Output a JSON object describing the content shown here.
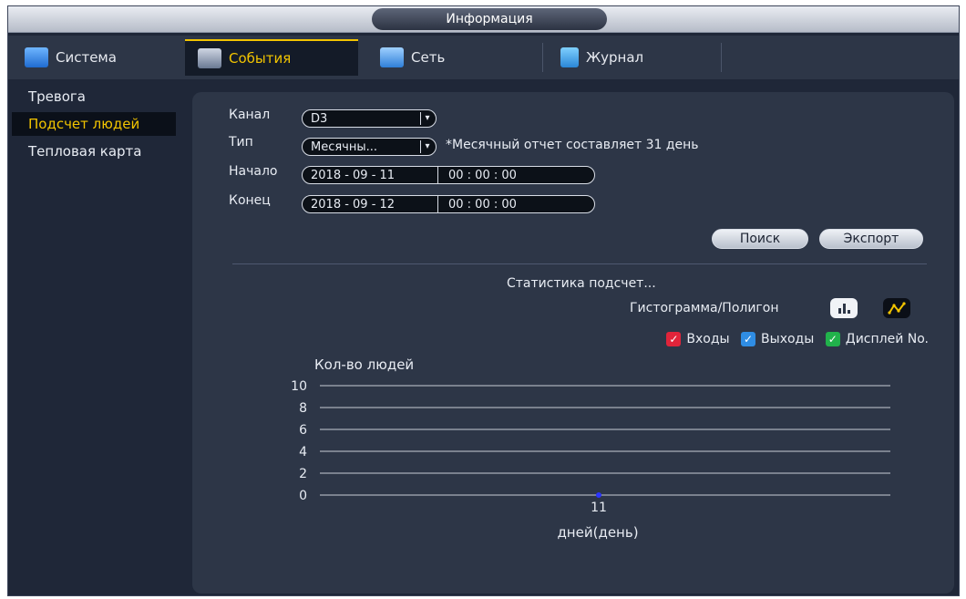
{
  "window": {
    "title": "Информация"
  },
  "tabs": [
    {
      "label": "Система",
      "icon": "monitor-icon"
    },
    {
      "label": "События",
      "icon": "events-icon"
    },
    {
      "label": "Сеть",
      "icon": "network-icon"
    },
    {
      "label": "Журнал",
      "icon": "journal-icon"
    }
  ],
  "sidebar": {
    "items": [
      {
        "label": "Тревога"
      },
      {
        "label": "Подсчет людей"
      },
      {
        "label": "Тепловая карта"
      }
    ]
  },
  "form": {
    "channel_label": "Канал",
    "channel_value": "D3",
    "type_label": "Тип",
    "type_value": "Месячны...",
    "type_note": "*Месячный отчет составляет 31 день",
    "start_label": "Начало",
    "start_date": "2018  - 09 - 11",
    "start_time": "00 : 00 : 00",
    "end_label": "Конец",
    "end_date": "2018  - 09 - 12",
    "end_time": "00 : 00 : 00",
    "search_button": "Поиск",
    "export_button": "Экспорт"
  },
  "stats": {
    "title": "Статистика подсчет...",
    "mode_label": "Гистограмма/Полигон",
    "legend": [
      {
        "label": "Входы",
        "color": "#e0243a"
      },
      {
        "label": "Выходы",
        "color": "#2f8de4"
      },
      {
        "label": "Дисплей No.",
        "color": "#21b24b"
      }
    ]
  },
  "colors": {
    "accent": "#f2c400",
    "panel": "#2d3647",
    "point": "#2b35ff"
  },
  "chart_data": {
    "type": "line",
    "ylabel": "Кол-во людей",
    "xlabel": "дней(день)",
    "yticks": [
      0,
      2,
      4,
      6,
      8,
      10
    ],
    "ylim": [
      0,
      10
    ],
    "categories": [
      "11"
    ],
    "values": [
      0
    ],
    "grid": true
  }
}
